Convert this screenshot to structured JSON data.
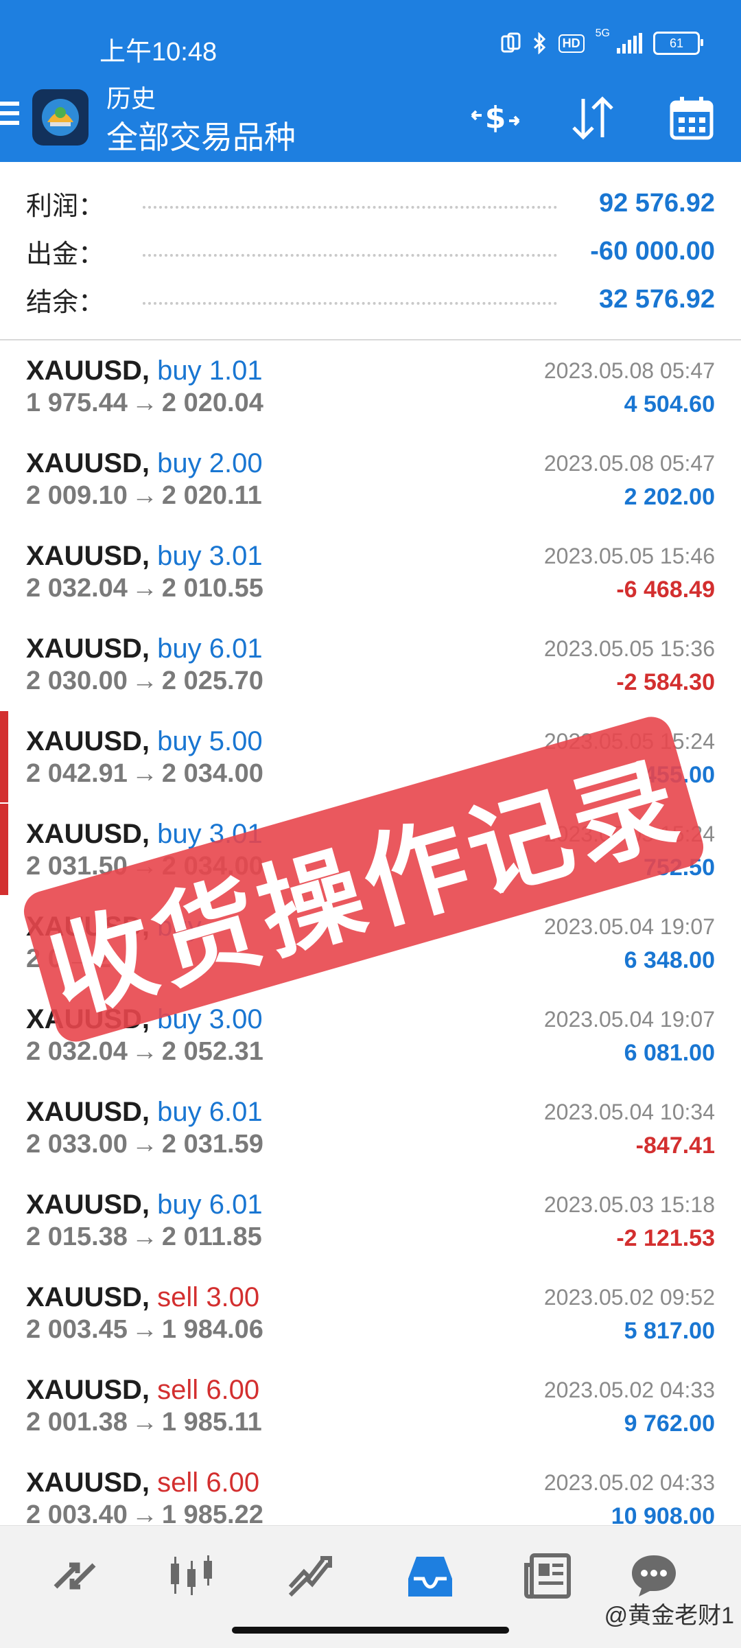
{
  "status_bar": {
    "time": "上午10:48",
    "network": "5G",
    "hd": "HD",
    "battery": "61"
  },
  "header": {
    "title": "历史",
    "subtitle": "全部交易品种",
    "accent_color": "#1e7fe0",
    "icons": [
      "menu-icon",
      "app-logo-icon",
      "deposit-currency-icon",
      "sort-icon",
      "calendar-icon"
    ]
  },
  "summary": {
    "profit_label": "利润：",
    "profit_value": "92 576.92",
    "withdraw_label": "出金：",
    "withdraw_value": "-60 000.00",
    "balance_label": "结余：",
    "balance_value": "32 576.92"
  },
  "trades": [
    {
      "symbol": "XAUUSD,",
      "side": "buy",
      "volume": "1.01",
      "open": "1 975.44",
      "close": "2 020.04",
      "time": "2023.05.08 05:47",
      "profit": "4 504.60",
      "marked": false
    },
    {
      "symbol": "XAUUSD,",
      "side": "buy",
      "volume": "2.00",
      "open": "2 009.10",
      "close": "2 020.11",
      "time": "2023.05.08 05:47",
      "profit": "2 202.00",
      "marked": false
    },
    {
      "symbol": "XAUUSD,",
      "side": "buy",
      "volume": "3.01",
      "open": "2 032.04",
      "close": "2 010.55",
      "time": "2023.05.05 15:46",
      "profit": "-6 468.49",
      "marked": false
    },
    {
      "symbol": "XAUUSD,",
      "side": "buy",
      "volume": "6.01",
      "open": "2 030.00",
      "close": "2 025.70",
      "time": "2023.05.05 15:36",
      "profit": "-2 584.30",
      "marked": false
    },
    {
      "symbol": "XAUUSD,",
      "side": "buy",
      "volume": "5.00",
      "open": "2 042.91",
      "close": "2 034.00",
      "time": "2023.05.05 15:24",
      "profit": "455.00",
      "marked": true
    },
    {
      "symbol": "XAUUSD,",
      "side": "buy",
      "volume": "3.01",
      "open": "2 031.50",
      "close": "2 034.00",
      "time": "2023.05.05 15:24",
      "profit": "752.50",
      "marked": true
    },
    {
      "symbol": "XAUUSD,",
      "side": "buy",
      "volume": "",
      "open": "2 0",
      "close": "2",
      "time": "2023.05.04 19:07",
      "profit": "6 348.00",
      "marked": false
    },
    {
      "symbol": "XAUUSD,",
      "side": "buy",
      "volume": "3.00",
      "open": "2 032.04",
      "close": "2 052.31",
      "time": "2023.05.04 19:07",
      "profit": "6 081.00",
      "marked": false
    },
    {
      "symbol": "XAUUSD,",
      "side": "buy",
      "volume": "6.01",
      "open": "2 033.00",
      "close": "2 031.59",
      "time": "2023.05.04 10:34",
      "profit": "-847.41",
      "marked": false
    },
    {
      "symbol": "XAUUSD,",
      "side": "buy",
      "volume": "6.01",
      "open": "2 015.38",
      "close": "2 011.85",
      "time": "2023.05.03 15:18",
      "profit": "-2 121.53",
      "marked": false
    },
    {
      "symbol": "XAUUSD,",
      "side": "sell",
      "volume": "3.00",
      "open": "2 003.45",
      "close": "1 984.06",
      "time": "2023.05.02 09:52",
      "profit": "5 817.00",
      "marked": false
    },
    {
      "symbol": "XAUUSD,",
      "side": "sell",
      "volume": "6.00",
      "open": "2 001.38",
      "close": "1 985.11",
      "time": "2023.05.02 04:33",
      "profit": "9 762.00",
      "marked": false
    },
    {
      "symbol": "XAUUSD,",
      "side": "sell",
      "volume": "6.00",
      "open": "2 003.40",
      "close": "1 985.22",
      "time": "2023.05.02 04:33",
      "profit": "10 908.00",
      "marked": false
    }
  ],
  "arrow": "→",
  "stamp_text": "收货操作记录",
  "bottom_nav": {
    "items": [
      "quotes-icon",
      "chart-icon",
      "trade-icon",
      "history-icon",
      "news-icon",
      "messages-icon"
    ],
    "active": "history-icon",
    "user_watermark": "@黄金老财1"
  },
  "colors": {
    "positive": "#1976d2",
    "negative": "#d32f2f",
    "stamp": "#e8464c"
  }
}
